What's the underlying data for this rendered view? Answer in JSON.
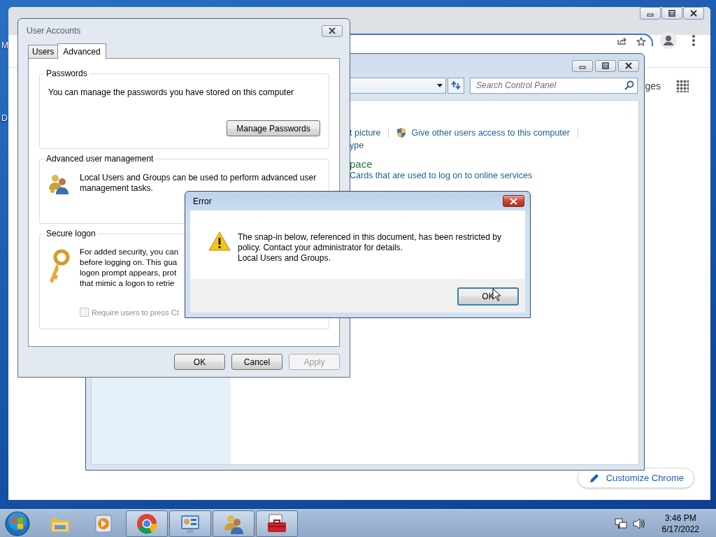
{
  "desktop": {
    "icon_labels": [
      "M",
      "D"
    ]
  },
  "browser": {
    "partial_text": "ges",
    "customize_button": "Customize Chrome"
  },
  "control_panel": {
    "search": {
      "placeholder": "Search Control Panel"
    },
    "links": [
      {
        "text": "t picture",
        "kind": "plain"
      },
      {
        "text": "Give other users access to this computer",
        "kind": "shield"
      }
    ],
    "link_2": "ype",
    "heading": "pace",
    "description": "Cards that are used to log on to online services"
  },
  "user_accounts": {
    "title": "User Accounts",
    "tabs": [
      {
        "label": "Users",
        "selected": false
      },
      {
        "label": "Advanced",
        "selected": true
      }
    ],
    "passwords": {
      "title": "Passwords",
      "text": "You can manage the passwords you have stored on this computer",
      "button": "Manage Passwords"
    },
    "advanced": {
      "title": "Advanced user management",
      "text": "Local Users and Groups can be used to perform advanced user management tasks."
    },
    "secure_logon": {
      "title": "Secure logon",
      "lines": [
        "For added security, you can",
        "before logging on. This gua",
        "logon prompt appears, prot",
        "that mimic a logon to retrie"
      ],
      "checkbox": {
        "label": "Require users to press Ct",
        "checked": false,
        "disabled": true
      }
    },
    "buttons": [
      {
        "label": "OK",
        "disabled": false
      },
      {
        "label": "Cancel",
        "disabled": false
      },
      {
        "label": "Apply",
        "disabled": true
      }
    ]
  },
  "error_dialog": {
    "title": "Error",
    "message": "The snap-in below, referenced in this document, has been restricted by policy. Contact your administrator for details.",
    "detail": "Local Users and Groups.",
    "button": "OK"
  },
  "taskbar": {
    "items": [
      {
        "kind": "explorer",
        "running": false
      },
      {
        "kind": "media",
        "running": false
      },
      {
        "kind": "chrome",
        "running": true
      },
      {
        "kind": "control-panel",
        "running": true
      },
      {
        "kind": "users",
        "running": true
      },
      {
        "kind": "toolbox",
        "running": true
      }
    ],
    "time": "3:46 PM",
    "date": "6/17/2022"
  }
}
